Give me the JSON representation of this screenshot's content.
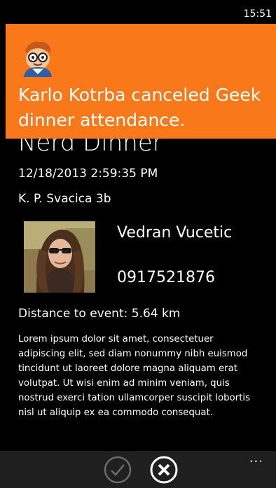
{
  "status_bar": {
    "time": "15:51"
  },
  "page": {
    "title": "Nerd Dinner",
    "datetime": "12/18/2013 2:59:35 PM",
    "address": "K. P. Svacica 3b",
    "contact": {
      "name": "Vedran Vucetic",
      "phone": "0917521876",
      "photo_icon": "person-photo"
    },
    "distance_label": "Distance to event:",
    "distance_value": "5.64 km",
    "description": "Lorem ipsum dolor sit amet, consectetuer adipiscing elit, sed diam nonummy nibh euismod tincidunt ut laoreet dolore magna aliquam erat volutpat. Ut wisi enim ad minim veniam, quis nostrud exerci tation ullamcorper suscipit lobortis nisl ut aliquip ex ea commodo consequat."
  },
  "toast": {
    "icon": "geek-avatar",
    "message": "Karlo Kotrba canceled Geek dinner attendance.",
    "color": "#f97819"
  },
  "app_bar": {
    "buttons": [
      {
        "icon": "check-icon",
        "state": "disabled"
      },
      {
        "icon": "close-icon",
        "state": "enabled"
      }
    ],
    "more": "..."
  }
}
